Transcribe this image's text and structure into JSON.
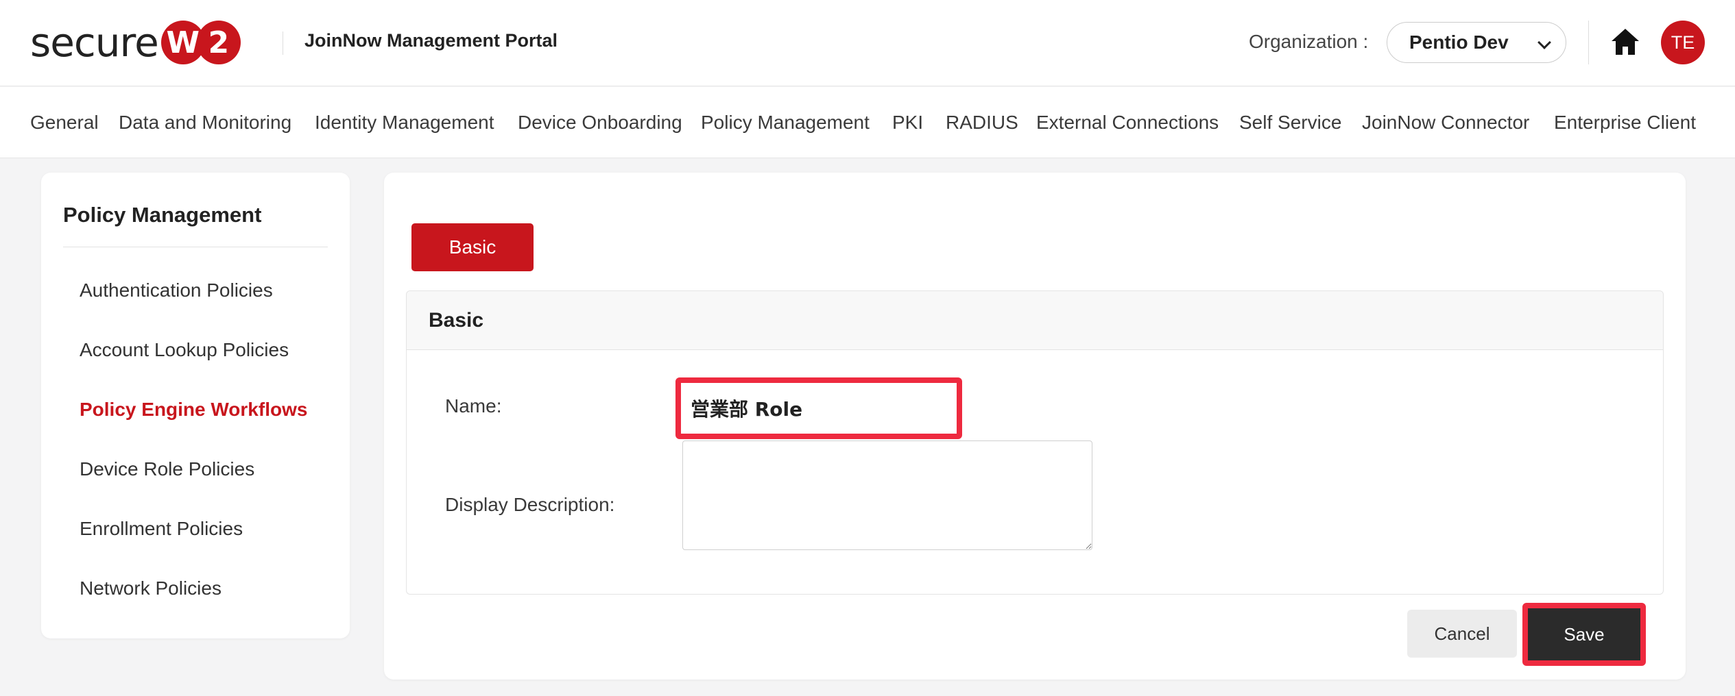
{
  "header": {
    "logo_text": "secure",
    "logo_badge": [
      "W",
      "2"
    ],
    "portal_title": "JoinNow Management Portal",
    "org_label": "Organization :",
    "org_value": "Pentio Dev",
    "avatar_initials": "TE",
    "home_icon": "home-icon",
    "brand_color": "#c8161d"
  },
  "nav": {
    "items": [
      "General",
      "Data and Monitoring",
      "Identity Management",
      "Device Onboarding",
      "Policy Management",
      "PKI",
      "RADIUS",
      "External Connections",
      "Self Service",
      "JoinNow Connector",
      "Enterprise Client"
    ]
  },
  "sidebar": {
    "title": "Policy Management",
    "items": [
      {
        "label": "Authentication Policies",
        "active": false
      },
      {
        "label": "Account Lookup Policies",
        "active": false
      },
      {
        "label": "Policy Engine Workflows",
        "active": true
      },
      {
        "label": "Device Role Policies",
        "active": false
      },
      {
        "label": "Enrollment Policies",
        "active": false
      },
      {
        "label": "Network Policies",
        "active": false
      }
    ]
  },
  "main": {
    "tab_label": "Basic",
    "panel_title": "Basic",
    "name_label": "Name:",
    "name_value": "営業部 Role",
    "description_label": "Display Description:",
    "description_value": "",
    "cancel_label": "Cancel",
    "save_label": "Save",
    "highlight_color": "#ee2a3f"
  }
}
